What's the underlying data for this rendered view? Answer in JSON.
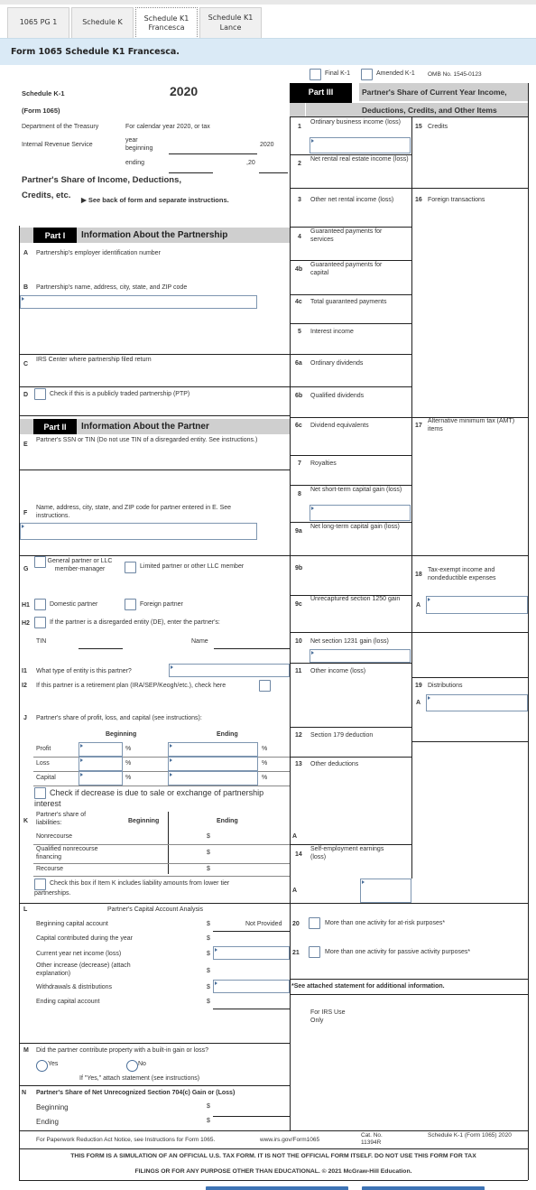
{
  "tabs": [
    {
      "label": "1065 PG 1",
      "active": false
    },
    {
      "label": "Schedule K",
      "active": false
    },
    {
      "label": "Schedule K1 Francesca",
      "active": true
    },
    {
      "label": "Schedule K1 Lance",
      "active": false
    }
  ],
  "banner": "Form 1065 Schedule K1 Francesca.",
  "header": {
    "final_k1": "Final K-1",
    "amended_k1": "Amended K-1",
    "omb": "OMB No. 1545-0123",
    "schedule": "Schedule K-1",
    "form": "(Form 1065)",
    "year": "2020",
    "dept": "Department of the Treasury",
    "irs": "Internal Revenue Service",
    "calendar": "For calendar year 2020, or tax",
    "year_beginning": "year beginning",
    "year_value": "2020",
    "ending": "ending",
    "comma20": ",20",
    "title_line1": "Partner's Share of Income, Deductions,",
    "title_line2": "Credits, etc.",
    "see_back": "▶ See back of form and separate instructions."
  },
  "part1": {
    "label": "Part I",
    "title": "Information About the Partnership",
    "A": {
      "letter": "A",
      "text": "Partnership's employer identification number"
    },
    "B": {
      "letter": "B",
      "text": "Partnership's name, address, city, state, and ZIP code",
      "value": ""
    },
    "C": {
      "letter": "C",
      "text": "IRS Center where partnership filed return"
    },
    "D": {
      "letter": "D",
      "text": "Check if this is a publicly traded partnership (PTP)",
      "checked": false
    }
  },
  "part2": {
    "label": "Part II",
    "title": "Information About the Partner",
    "E": {
      "letter": "E",
      "text": "Partner's SSN or TIN (Do not use TIN of a disregarded entity. See instructions.)"
    },
    "F": {
      "letter": "F",
      "text": "Name, address, city, state, and ZIP code for partner entered in E. See instructions.",
      "value": ""
    },
    "G": {
      "letter": "G",
      "general": "General partner or LLC member-manager",
      "limited": "Limited partner or other LLC member"
    },
    "H1": {
      "letter": "H1",
      "domestic": "Domestic partner",
      "foreign": "Foreign partner"
    },
    "H2": {
      "letter": "H2",
      "text": "If the partner is a disregarded entity (DE), enter the partner's:",
      "tin": "TIN",
      "name": "Name"
    },
    "I1": {
      "letter": "I1",
      "text": "What type of entity is this partner?",
      "value": ""
    },
    "I2": {
      "letter": "I2",
      "text": "If this partner is a retirement plan (IRA/SEP/Keogh/etc.), check here"
    },
    "J": {
      "letter": "J",
      "text": "Partner's share of profit, loss, and capital (see instructions):",
      "beginning": "Beginning",
      "ending": "Ending",
      "pct": "%",
      "rows": [
        {
          "label": "Profit",
          "beginning": "",
          "ending": ""
        },
        {
          "label": "Loss",
          "beginning": "",
          "ending": ""
        },
        {
          "label": "Capital",
          "beginning": "",
          "ending": ""
        }
      ],
      "decrease_text": "Check if decrease is due to sale or exchange of partnership interest"
    },
    "K": {
      "letter": "K",
      "text": "Partner's share of liabilities:",
      "beginning": "Beginning",
      "ending": "Ending",
      "dollar": "$",
      "rows": [
        "Nonrecourse",
        "Qualified nonrecourse financing",
        "Recourse"
      ],
      "lower_tier": "Check this box if Item K includes liability amounts from lower tier partnerships."
    },
    "L": {
      "letter": "L",
      "title": "Partner's Capital Account Analysis",
      "dollar": "$",
      "rows": [
        {
          "label": "Beginning capital account",
          "value": "Not Provided"
        },
        {
          "label": "Capital contributed during the year",
          "value": ""
        },
        {
          "label": "Current year net income (loss)",
          "value": ""
        },
        {
          "label": "Other increase (decrease) (attach explanation)",
          "value": ""
        },
        {
          "label": "Withdrawals & distributions",
          "value": ""
        },
        {
          "label": "Ending capital account",
          "value": ""
        }
      ]
    },
    "M": {
      "letter": "M",
      "text": "Did the partner contribute property with a built-in gain or loss?",
      "yes": "Yes",
      "no": "No",
      "note": "If \"Yes,\" attach statement (see instructions)"
    },
    "N": {
      "letter": "N",
      "text": "Partner's Share of Net Unrecognized Section 704(c) Gain or (Loss)",
      "beginning": "Beginning",
      "ending": "Ending",
      "dollar": "$"
    }
  },
  "part3": {
    "label": "Part III",
    "title1": "Partner's Share of Current Year Income,",
    "title2": "Deductions, Credits, and Other Items",
    "lines": {
      "l1": {
        "num": "1",
        "text": "Ordinary business income (loss)"
      },
      "l2": {
        "num": "2",
        "text": "Net rental real estate income (loss)"
      },
      "l3": {
        "num": "3",
        "text": "Other net rental income (loss)"
      },
      "l4": {
        "num": "4",
        "text": "Guaranteed payments for services"
      },
      "l4b": {
        "num": "4b",
        "text": "Guaranteed payments for capital"
      },
      "l4c": {
        "num": "4c",
        "text": "Total guaranteed payments"
      },
      "l5": {
        "num": "5",
        "text": "Interest income"
      },
      "l6a": {
        "num": "6a",
        "text": "Ordinary dividends"
      },
      "l6b": {
        "num": "6b",
        "text": "Qualified dividends"
      },
      "l6c": {
        "num": "6c",
        "text": "Dividend equivalents"
      },
      "l7": {
        "num": "7",
        "text": "Royalties"
      },
      "l8": {
        "num": "8",
        "text": "Net short-term capital gain (loss)"
      },
      "l9a": {
        "num": "9a",
        "text": "Net long-term capital gain (loss)"
      },
      "l9b": {
        "num": "9b",
        "text": ""
      },
      "l9c": {
        "num": "9c",
        "text": "Unrecaptured section 1250 gain"
      },
      "l10": {
        "num": "10",
        "text": "Net section 1231 gain (loss)"
      },
      "l11": {
        "num": "11",
        "text": "Other income (loss)"
      },
      "l12": {
        "num": "12",
        "text": "Section 179 deduction"
      },
      "l13": {
        "num": "13",
        "text": "Other deductions"
      },
      "l14": {
        "num": "14",
        "text": "Self-employment earnings (loss)"
      },
      "l15": {
        "num": "15",
        "text": "Credits"
      },
      "l16": {
        "num": "16",
        "text": "Foreign transactions"
      },
      "l17": {
        "num": "17",
        "text": "Alternative minimum tax (AMT) items"
      },
      "l18": {
        "num": "18",
        "text": "Tax-exempt income and nondeductible expenses"
      },
      "l19": {
        "num": "19",
        "text": "Distributions"
      },
      "l20": {
        "num": "20",
        "text": "More than one activity for at-risk purposes*"
      },
      "l21": {
        "num": "21",
        "text": "More than one activity for passive activity purposes*"
      }
    },
    "code_a": "A",
    "see_attached": "*See attached statement for additional information.",
    "irs_use": "For IRS Use Only"
  },
  "footer": {
    "paperwork": "For Paperwork Reduction Act Notice, see Instructions for Form 1065.",
    "url": "www.irs.gov/Form1065",
    "cat": "Cat. No. 11394R",
    "schedule": "Schedule K-1 (Form 1065) 2020",
    "disclaimer1": "THIS FORM IS A SIMULATION OF AN OFFICIAL U.S. TAX FORM. IT IS NOT THE OFFICIAL FORM ITSELF. DO NOT USE THIS FORM FOR TAX",
    "disclaimer2": "FILINGS OR FOR ANY PURPOSE OTHER THAN EDUCATIONAL. © 2021 McGraw-Hill Education."
  }
}
